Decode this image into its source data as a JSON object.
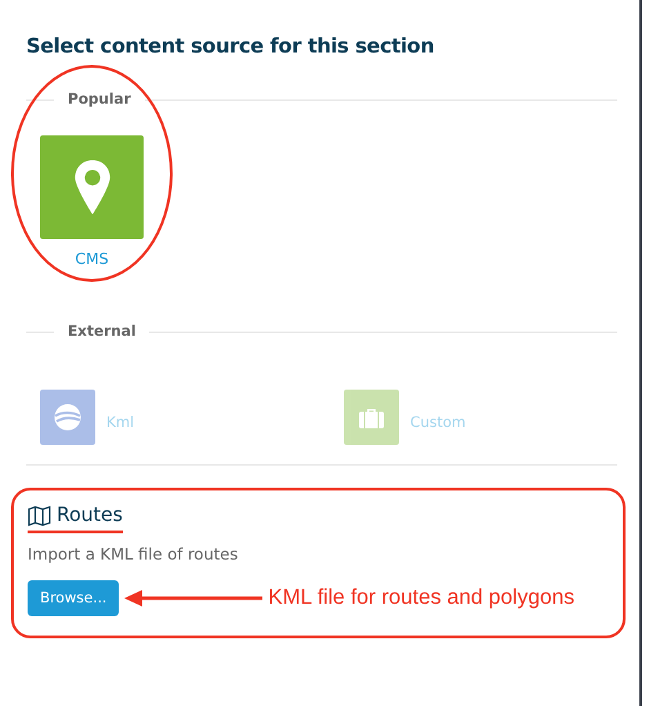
{
  "title": "Select content source for this section",
  "groups": [
    {
      "label": "Popular",
      "items": [
        {
          "label": "CMS",
          "kind": "pin",
          "disabled": false,
          "highlighted": true
        }
      ]
    },
    {
      "label": "External",
      "items": [
        {
          "label": "Kml",
          "kind": "globe",
          "disabled": true
        },
        {
          "label": "Custom",
          "kind": "briefcase",
          "disabled": true
        }
      ]
    }
  ],
  "routes": {
    "title": "Routes",
    "description": "Import a KML file of routes",
    "button": "Browse...",
    "highlighted": true,
    "annotation": "KML file for routes and polygons"
  }
}
